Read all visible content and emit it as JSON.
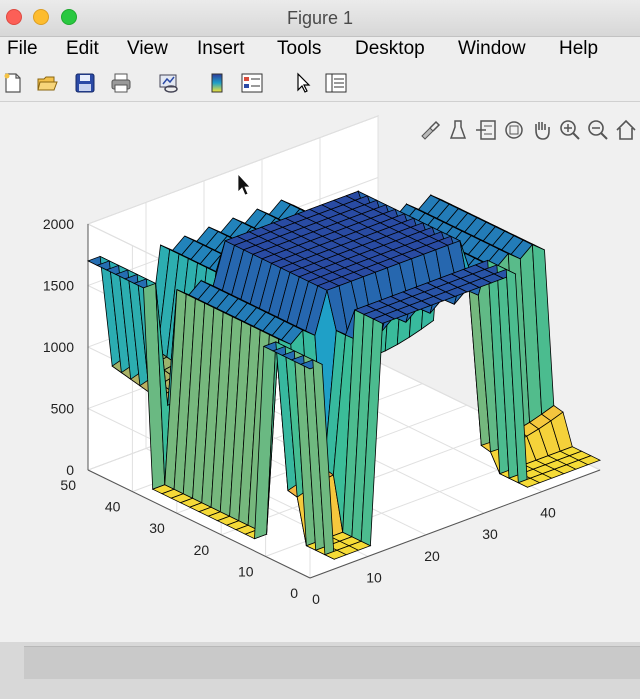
{
  "window": {
    "title": "Figure 1"
  },
  "menu": [
    "File",
    "Edit",
    "View",
    "Insert",
    "Tools",
    "Desktop",
    "Window",
    "Help"
  ],
  "toolbar_icons": [
    "new-figure-icon",
    "open-file-icon",
    "save-icon",
    "print-icon",
    "link-plot-icon",
    "colorbar-icon",
    "legend-icon",
    "edit-plot-arrow-icon",
    "property-inspector-icon"
  ],
  "axes_toolbar_icons": [
    "brush-icon",
    "data-cursor-icon",
    "export-icon",
    "rotate-3d-icon",
    "pan-icon",
    "zoom-in-icon",
    "zoom-out-icon",
    "home-icon"
  ],
  "colors": {
    "surface_high": "#2b3a9c",
    "surface_mid": "#1fa0c7",
    "surface_low": "#f5e335",
    "edge": "#000000"
  },
  "chart_data": {
    "type": "surface",
    "x_ticks": [
      "0",
      "10",
      "20",
      "30",
      "40"
    ],
    "y_ticks": [
      "0",
      "10",
      "20",
      "30",
      "40",
      "50"
    ],
    "z_ticks": [
      "0",
      "500",
      "1000",
      "1500",
      "2000"
    ],
    "xlim": [
      0,
      50
    ],
    "ylim": [
      0,
      50
    ],
    "zlim": [
      0,
      2000
    ],
    "grid": true,
    "colormap": "parula",
    "view": "3d",
    "description_values": {
      "peak_height": 1900,
      "plateau_low_height": 500,
      "front_ridge_count": 20,
      "grid_peaks_rows": 11,
      "grid_peaks_cols": 11
    }
  }
}
